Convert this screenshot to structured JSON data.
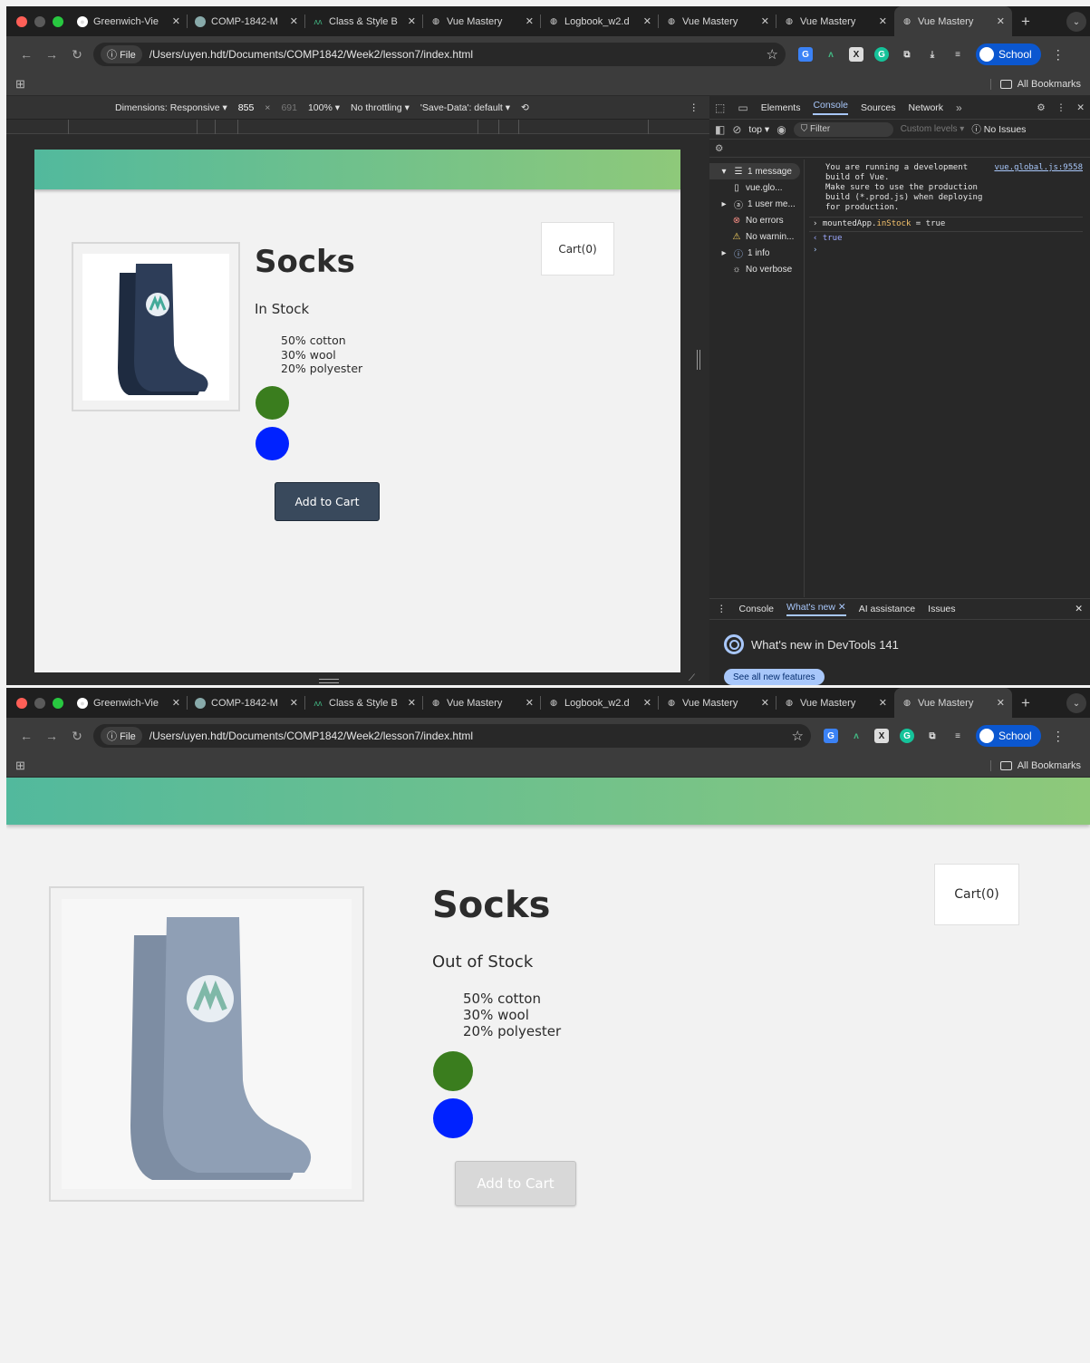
{
  "browser": {
    "tabs": [
      {
        "label": "Greenwich-Vie",
        "icon": "github-icon"
      },
      {
        "label": "COMP-1842-M",
        "icon": "course-icon"
      },
      {
        "label": "Class & Style B",
        "icon": "vue-mastery-icon"
      },
      {
        "label": "Vue Mastery",
        "icon": "globe-icon"
      },
      {
        "label": "Logbook_w2.d",
        "icon": "globe-icon"
      },
      {
        "label": "Vue Mastery",
        "icon": "globe-icon"
      },
      {
        "label": "Vue Mastery",
        "icon": "globe-icon"
      },
      {
        "label": "Vue Mastery",
        "icon": "globe-icon",
        "active": true
      }
    ],
    "file_chip": "File",
    "url": "/Users/uyen.hdt/Documents/COMP1842/Week2/lesson7/index.html",
    "profile_label": "School",
    "bookmarks_label": "All Bookmarks"
  },
  "device_toolbar": {
    "dimensions_label": "Dimensions: Responsive",
    "width": "855",
    "height": "691",
    "zoom": "100%",
    "throttling": "No throttling",
    "save_data": "'Save-Data': default"
  },
  "devtools": {
    "tabs": [
      "Elements",
      "Console",
      "Sources",
      "Network"
    ],
    "active_tab": "Console",
    "context": "top",
    "filter_placeholder": "Filter",
    "levels": "Custom levels",
    "issues": "No Issues",
    "sidebar": [
      {
        "label": "1 message",
        "icon": "list-icon"
      },
      {
        "label": "vue.glo...",
        "icon": "file-icon"
      },
      {
        "label": "1 user me...",
        "icon": "user-icon"
      },
      {
        "label": "No errors",
        "icon": "error-icon"
      },
      {
        "label": "No warnin...",
        "icon": "warning-icon"
      },
      {
        "label": "1 info",
        "icon": "info-icon"
      },
      {
        "label": "No verbose",
        "icon": "bug-icon"
      }
    ],
    "console_message": "You are running a development build of Vue.\nMake sure to use the production build (*.prod.js) when deploying for production.",
    "console_source": "vue.global.js:9558",
    "console_input_prefix": "mountedApp.",
    "console_input_prop": "inStock",
    "console_input_suffix": " = true",
    "console_result": "true",
    "drawer_tabs": [
      "Console",
      "What's new",
      "AI assistance",
      "Issues"
    ],
    "whats_new_title": "What's new in DevTools 141",
    "see_all_label": "See all new features"
  },
  "product_before": {
    "title": "Socks",
    "stock_status": "In Stock",
    "details": [
      "50% cotton",
      "30% wool",
      "20% polyester"
    ],
    "variant_colors": [
      "#3a7d1e",
      "#0022ff"
    ],
    "cart_label": "Cart(0)",
    "add_button_label": "Add to Cart",
    "sock_color": "#2d3d58"
  },
  "product_after": {
    "title": "Socks",
    "stock_status": "Out of Stock",
    "details": [
      "50% cotton",
      "30% wool",
      "20% polyester"
    ],
    "variant_colors": [
      "#3a7d1e",
      "#0022ff"
    ],
    "cart_label": "Cart(0)",
    "add_button_label": "Add to Cart",
    "sock_color": "#8f9fb5"
  }
}
